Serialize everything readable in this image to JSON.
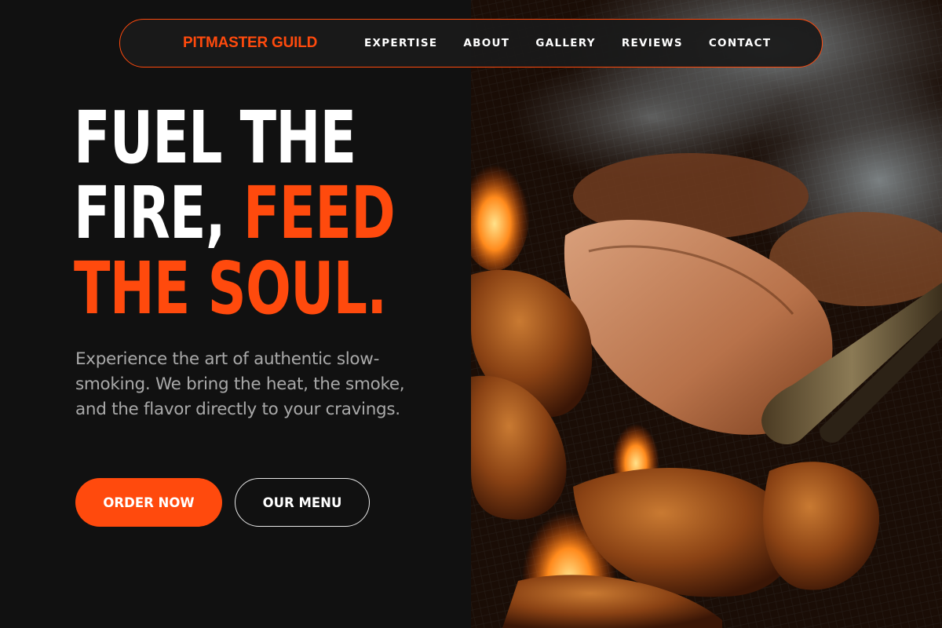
{
  "brand": {
    "name": "PITMASTER GUILD"
  },
  "nav": {
    "items": [
      {
        "label": "EXPERTISE"
      },
      {
        "label": "ABOUT"
      },
      {
        "label": "GALLERY"
      },
      {
        "label": "REVIEWS"
      },
      {
        "label": "CONTACT"
      }
    ]
  },
  "hero": {
    "headline_line1": "FUEL THE",
    "headline_line2_white": "FIRE, ",
    "headline_line2_accent": "FEED",
    "headline_line3": "THE SOUL.",
    "description": "Experience the art of authentic slow-smoking. We bring the heat, the smoke, and the flavor directly to your cravings.",
    "primary_cta": "ORDER NOW",
    "secondary_cta": "OUR MENU",
    "image_icon": "grilled-meat-photo"
  },
  "colors": {
    "accent": "#ff4a0d",
    "background": "#111111",
    "text_primary": "#ffffff",
    "text_secondary": "#a9a9a9"
  }
}
